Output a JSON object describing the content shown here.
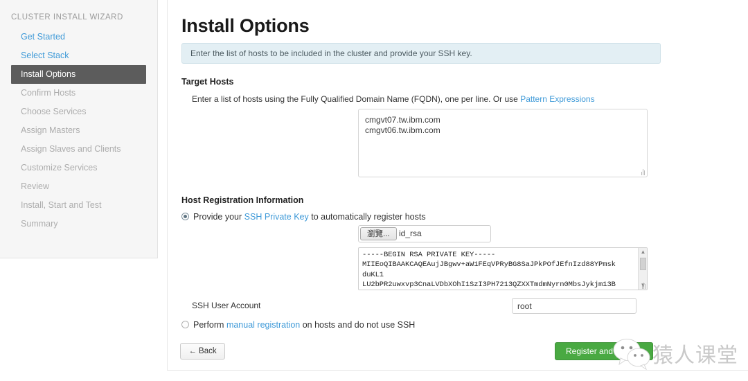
{
  "sidebar": {
    "title": "CLUSTER INSTALL WIZARD",
    "items": [
      {
        "label": "Get Started",
        "state": "link"
      },
      {
        "label": "Select Stack",
        "state": "link"
      },
      {
        "label": "Install Options",
        "state": "active"
      },
      {
        "label": "Confirm Hosts",
        "state": "disabled"
      },
      {
        "label": "Choose Services",
        "state": "disabled"
      },
      {
        "label": "Assign Masters",
        "state": "disabled"
      },
      {
        "label": "Assign Slaves and Clients",
        "state": "disabled"
      },
      {
        "label": "Customize Services",
        "state": "disabled"
      },
      {
        "label": "Review",
        "state": "disabled"
      },
      {
        "label": "Install, Start and Test",
        "state": "disabled"
      },
      {
        "label": "Summary",
        "state": "disabled"
      }
    ]
  },
  "main": {
    "page_title": "Install Options",
    "info_alert": "Enter the list of hosts to be included in the cluster and provide your SSH key.",
    "target_hosts": {
      "section_title": "Target Hosts",
      "helper_prefix": "Enter a list of hosts using the Fully Qualified Domain Name (FQDN), one per line. Or use ",
      "helper_link": "Pattern Expressions",
      "value": "cmgvt07.tw.ibm.com\ncmgvt06.tw.ibm.com",
      "placeholder": ""
    },
    "host_registration": {
      "section_title": "Host Registration Information",
      "ssh_option": {
        "prefix": "Provide your ",
        "link": "SSH Private Key",
        "suffix": " to automatically register hosts",
        "selected": true
      },
      "file_picker": {
        "browse_label": "瀏覽...",
        "file_name": "id_rsa"
      },
      "private_key_value": "-----BEGIN RSA PRIVATE KEY-----\nMIIEoQIBAAKCAQEAujJBgwv+aW1FEqVPRyBG8SaJPkPOfJEfnIzd88YPmsk\nduKL1\nLU2bPR2uwxvp3CnaLVDbXOhI1SzI3PH7213QZXXTmdmNyrn0MbsJykjm13B",
      "ssh_user_label": "SSH User Account",
      "ssh_user_value": "root",
      "ssh_user_placeholder": "",
      "manual_option": {
        "prefix": "Perform ",
        "link": "manual registration",
        "suffix": " on hosts and do not use SSH",
        "selected": false
      }
    },
    "buttons": {
      "back_label": "← Back",
      "register_label": "Register and Confirm"
    }
  },
  "watermark": {
    "text": "猿人课堂",
    "logo_name": "wechat-logo"
  },
  "colors": {
    "accent_link": "#3f9ad8",
    "active_nav_bg": "#5c5c5c",
    "info_bg": "#e3eff4",
    "info_border": "#cfe1e8",
    "primary_green": "#49a942",
    "watermark_green": "#5fb85c"
  }
}
